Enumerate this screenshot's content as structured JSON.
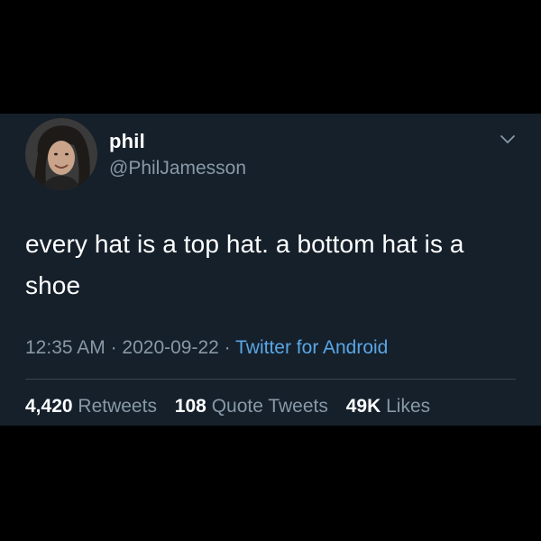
{
  "tweet": {
    "author": {
      "display_name": "phil",
      "handle": "@PhilJamesson",
      "avatar_icon": "profile-photo"
    },
    "menu_icon": "chevron-down-icon",
    "text": "every hat is a top hat. a bottom hat is a shoe",
    "meta": {
      "time": "12:35 AM",
      "separator_1": " · ",
      "date": "2020-09-22",
      "separator_2": " · ",
      "source": "Twitter for Android"
    },
    "stats": {
      "retweets_count": "4,420",
      "retweets_label": "Retweets",
      "quote_tweets_count": "108",
      "quote_tweets_label": "Quote Tweets",
      "likes_count": "49K",
      "likes_label": "Likes"
    }
  },
  "colors": {
    "background_outer": "#000000",
    "card_background": "#15202b",
    "text_primary": "#ffffff",
    "text_secondary": "#8899a6",
    "link": "#5aa6e6",
    "divider": "#38444d"
  }
}
